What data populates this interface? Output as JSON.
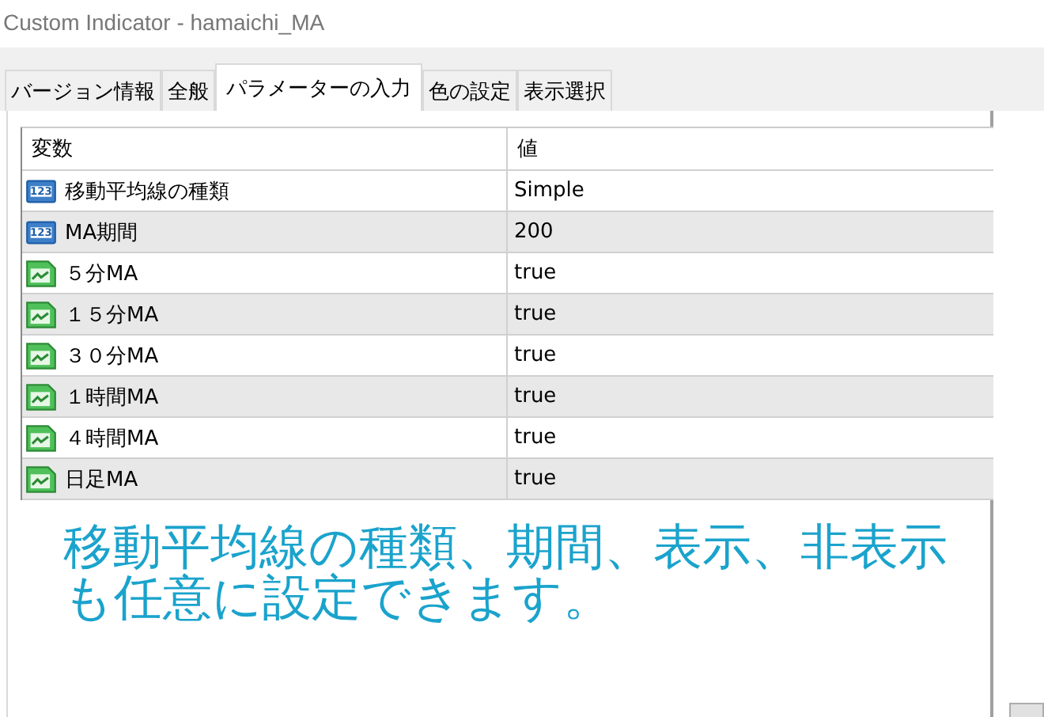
{
  "window": {
    "title": "Custom Indicator - hamaichi_MA"
  },
  "tabs": [
    {
      "label": "バージョン情報",
      "selected": false
    },
    {
      "label": "全般",
      "selected": false
    },
    {
      "label": "パラメーターの入力",
      "selected": true
    },
    {
      "label": "色の設定",
      "selected": false
    },
    {
      "label": "表示選択",
      "selected": false
    }
  ],
  "table": {
    "columns": [
      "変数",
      "値"
    ],
    "rows": [
      {
        "kind": "number",
        "icon_text": "123",
        "name": "移動平均線の種類",
        "value": "Simple"
      },
      {
        "kind": "number",
        "icon_text": "123",
        "name": "MA期間",
        "value": "200"
      },
      {
        "kind": "bool",
        "name": "５分MA",
        "value": "true"
      },
      {
        "kind": "bool",
        "name": "１５分MA",
        "value": "true"
      },
      {
        "kind": "bool",
        "name": "３０分MA",
        "value": "true"
      },
      {
        "kind": "bool",
        "name": "１時間MA",
        "value": "true"
      },
      {
        "kind": "bool",
        "name": "４時間MA",
        "value": "true"
      },
      {
        "kind": "bool",
        "name": "日足MA",
        "value": "true"
      }
    ]
  },
  "annotation": "移動平均線の種類、期間、表示、非表示も任意に設定できます。"
}
